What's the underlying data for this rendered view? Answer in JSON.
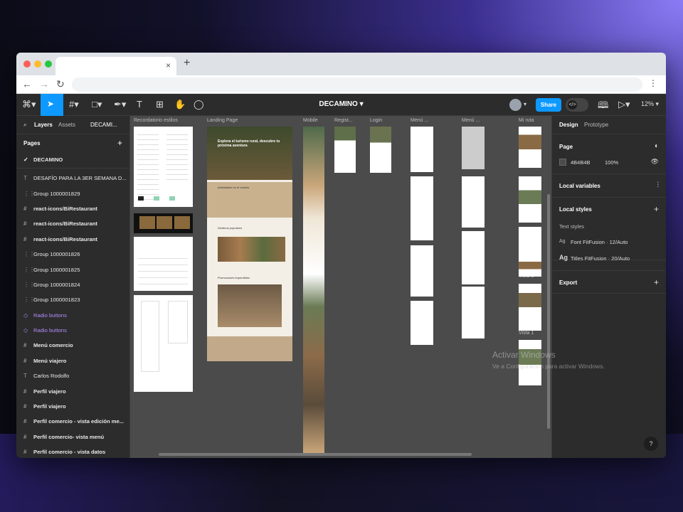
{
  "browser": {
    "new_tab": "+",
    "close_tab": "×",
    "back": "←",
    "forward": "→",
    "reload": "↻",
    "menu": "⋮"
  },
  "toolbar": {
    "doc_title": "DECAMINO",
    "share_label": "Share",
    "zoom": "12%"
  },
  "left_panel": {
    "tabs": {
      "layers": "Layers",
      "assets": "Assets",
      "page_menu": "DECAMI..."
    },
    "pages_title": "Pages",
    "pages": [
      {
        "label": "DECAMINO",
        "selected": true
      }
    ],
    "layers": [
      {
        "icon": "T",
        "label": "DESAFÍO PARA LA 3ER SEMANA D...",
        "style": "normal"
      },
      {
        "icon": "⋮⋮",
        "label": "Group 1000001829",
        "style": "normal"
      },
      {
        "icon": "#",
        "label": "react-icons/BiRestaurant",
        "style": "bold"
      },
      {
        "icon": "#",
        "label": "react-icons/BiRestaurant",
        "style": "bold"
      },
      {
        "icon": "#",
        "label": "react-icons/BiRestaurant",
        "style": "bold"
      },
      {
        "icon": "⋮⋮",
        "label": "Group 1000001826",
        "style": "normal"
      },
      {
        "icon": "⋮⋮",
        "label": "Group 1000001825",
        "style": "normal"
      },
      {
        "icon": "⋮⋮",
        "label": "Group 1000001824",
        "style": "normal"
      },
      {
        "icon": "⋮⋮",
        "label": "Group 1000001823",
        "style": "normal"
      },
      {
        "icon": "◇",
        "label": "Radio buttons",
        "style": "purple"
      },
      {
        "icon": "◇",
        "label": "Radio buttons",
        "style": "purple"
      },
      {
        "icon": "#",
        "label": "Menú comercio",
        "style": "bold"
      },
      {
        "icon": "#",
        "label": "Menú viajero",
        "style": "bold"
      },
      {
        "icon": "T",
        "label": "Carlos Rodolfo",
        "style": "normal"
      },
      {
        "icon": "#",
        "label": "Perfil viajero",
        "style": "bold"
      },
      {
        "icon": "#",
        "label": "Perfil viajero",
        "style": "bold"
      },
      {
        "icon": "#",
        "label": "Perfil comercio - vista edición me...",
        "style": "bold"
      },
      {
        "icon": "#",
        "label": "Perfil comercio- vista menú",
        "style": "bold"
      },
      {
        "icon": "#",
        "label": "Perfil comercio - vista datos",
        "style": "bold"
      }
    ]
  },
  "canvas": {
    "frame_labels": [
      "Recordatorio estilos",
      "Landing Page",
      "Mobile",
      "Regist...",
      "Login",
      "Menú ...",
      "Menú ...",
      "Mi ruta",
      "Vista 1",
      "Vista 1"
    ],
    "landing": {
      "hero_title": "Explora el turismo rural, descubre tu próxima aventura",
      "section1": "Actividades en el camino",
      "section2": "Destinos populares",
      "section3": "Promociones imperdibles"
    }
  },
  "right_panel": {
    "tabs": {
      "design": "Design",
      "prototype": "Prototype"
    },
    "page": {
      "title": "Page",
      "color": "4B4B4B",
      "opacity": "100%"
    },
    "local_variables": "Local variables",
    "local_styles": {
      "title": "Local styles",
      "subtitle": "Text styles",
      "items": [
        "Font FitFusion · 12/Auto",
        "Titles FitFusion · 20/Auto"
      ]
    },
    "export": "Export"
  },
  "watermark": {
    "line1": "Activar Windows",
    "line2": "Ve a Configuración para activar Windows."
  },
  "help": "?"
}
